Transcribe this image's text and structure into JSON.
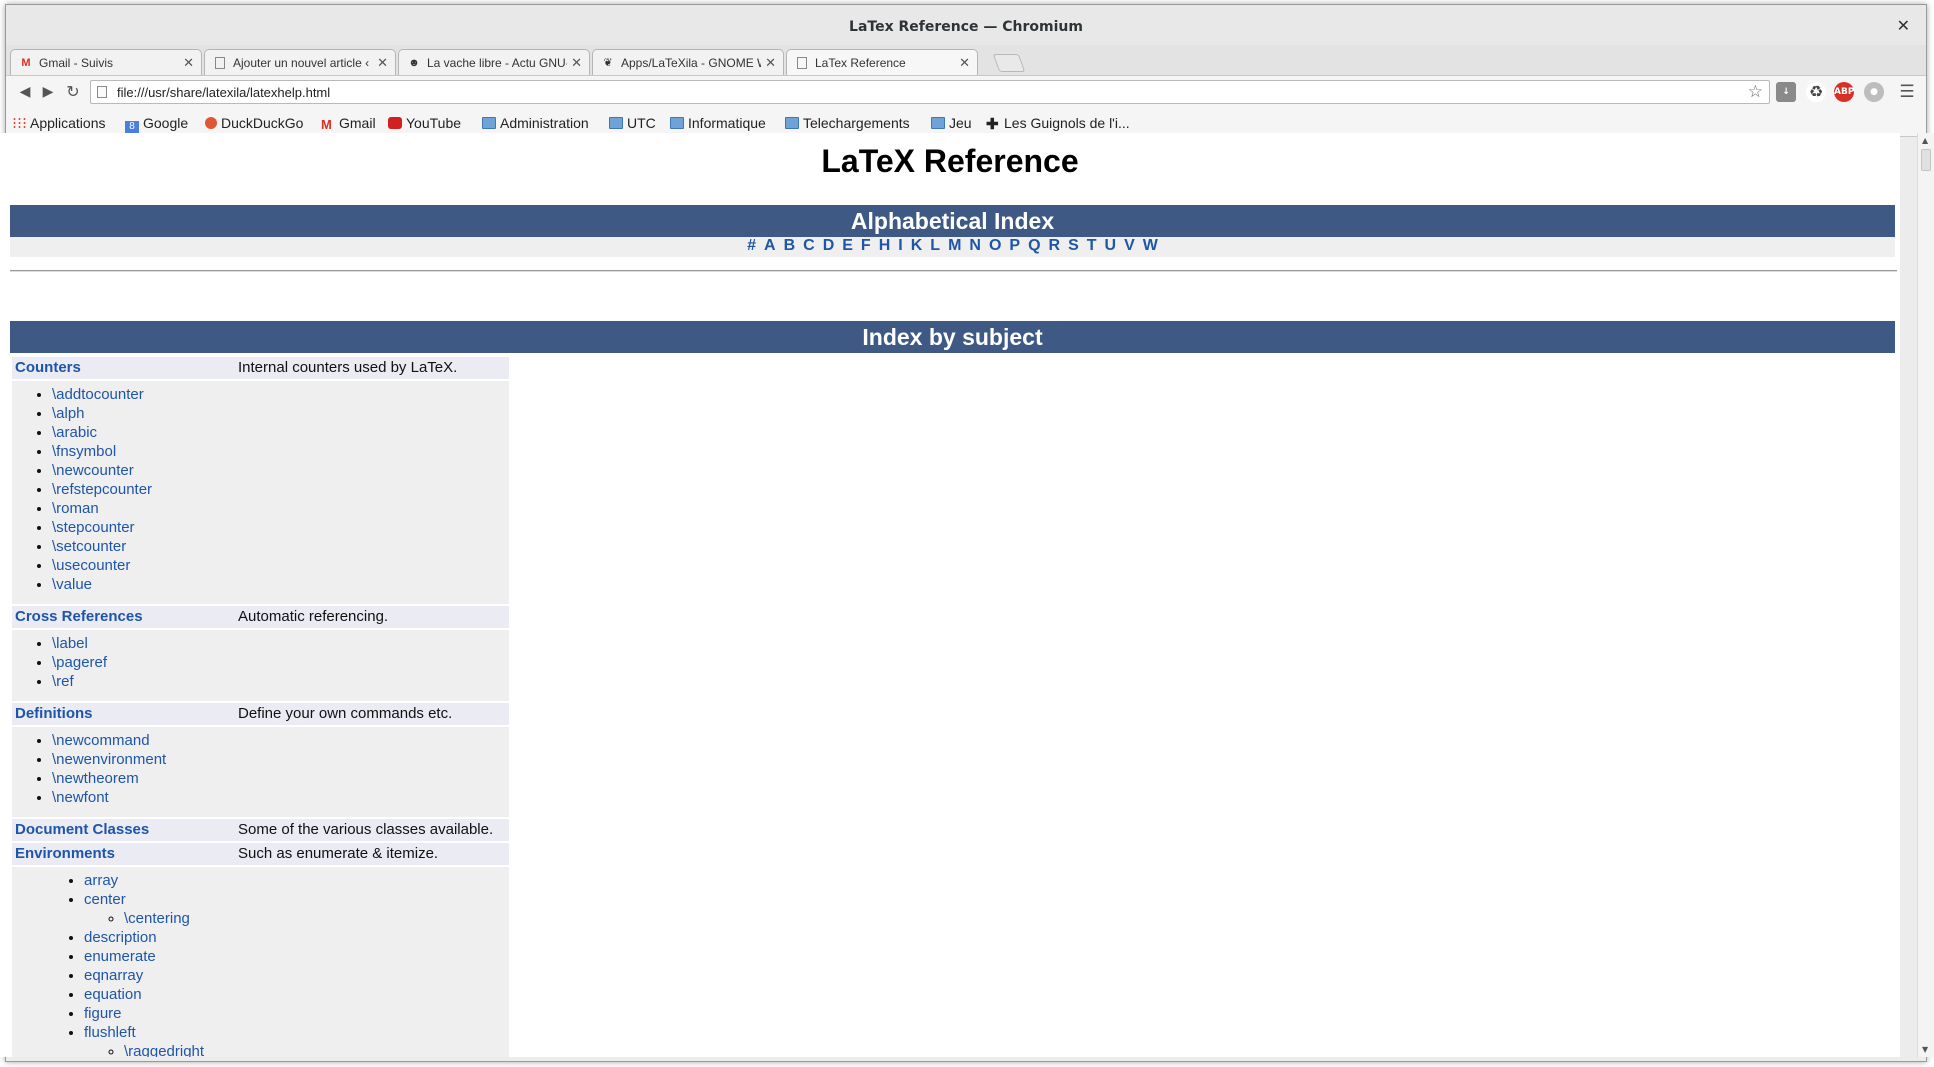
{
  "window": {
    "title": "LaTex Reference — Chromium"
  },
  "tabs": [
    {
      "label": "Gmail - Suivis",
      "icon": "gmail-icon"
    },
    {
      "label": "Ajouter un nouvel article ‹ L",
      "icon": "page-icon"
    },
    {
      "label": "La vache libre - Actu GNU-",
      "icon": "cow-icon"
    },
    {
      "label": "Apps/LaTeXila - GNOME W",
      "icon": "gnome-icon"
    },
    {
      "label": "LaTex Reference",
      "icon": "page-icon"
    }
  ],
  "toolbar": {
    "url": "file:///usr/share/latexila/latexhelp.html"
  },
  "bookmarks": [
    {
      "label": "Applications"
    },
    {
      "label": "Google"
    },
    {
      "label": "DuckDuckGo"
    },
    {
      "label": "Gmail"
    },
    {
      "label": "YouTube"
    },
    {
      "label": "Administration"
    },
    {
      "label": "UTC"
    },
    {
      "label": "Informatique"
    },
    {
      "label": "Telechargements"
    },
    {
      "label": "Jeu"
    },
    {
      "label": "Les Guignols de l'i..."
    }
  ],
  "page": {
    "title": "LaTeX Reference",
    "alpha_heading": "Alphabetical Index",
    "alpha_letters": [
      "#",
      "A",
      "B",
      "C",
      "D",
      "E",
      "F",
      "H",
      "I",
      "K",
      "L",
      "M",
      "N",
      "O",
      "P",
      "Q",
      "R",
      "S",
      "T",
      "U",
      "V",
      "W"
    ],
    "subject_heading": "Index by subject",
    "subjects": [
      {
        "name": "Counters",
        "desc": "Internal counters used by LaTeX.",
        "items": [
          "\\addtocounter",
          "\\alph",
          "\\arabic",
          "\\fnsymbol",
          "\\newcounter",
          "\\refstepcounter",
          "\\roman",
          "\\stepcounter",
          "\\setcounter",
          "\\usecounter",
          "\\value"
        ]
      },
      {
        "name": "Cross References",
        "desc": "Automatic referencing.",
        "items": [
          "\\label",
          "\\pageref",
          "\\ref"
        ]
      },
      {
        "name": "Definitions",
        "desc": "Define your own commands etc.",
        "items": [
          "\\newcommand",
          "\\newenvironment",
          "\\newtheorem",
          "\\newfont"
        ]
      },
      {
        "name": "Document Classes",
        "desc": "Some of the various classes available.",
        "items": []
      },
      {
        "name": "Environments",
        "desc": "Such as enumerate & itemize.",
        "items": [
          "array",
          "center",
          "description",
          "enumerate",
          "eqnarray",
          "equation",
          "figure",
          "flushleft"
        ],
        "sub_items": {
          "center": [
            "\\centering"
          ],
          "flushleft": [
            "\\raggedright"
          ]
        }
      }
    ]
  }
}
